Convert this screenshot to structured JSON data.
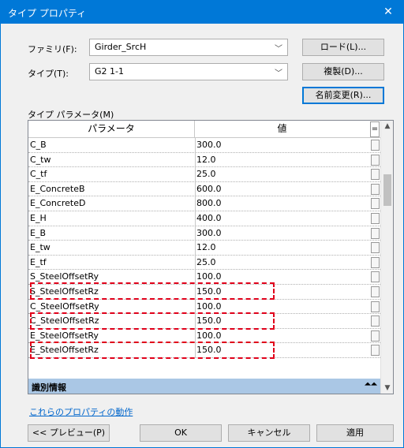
{
  "window": {
    "title": "タイプ プロパティ",
    "close_glyph": "✕"
  },
  "family": {
    "label": "ファミリ(F):",
    "value": "Girder_SrcH"
  },
  "type": {
    "label": "タイプ(T):",
    "value": "G2 1-1"
  },
  "buttons": {
    "load": "ロード(L)...",
    "duplicate": "複製(D)...",
    "rename": "名前変更(R)..."
  },
  "type_params_label": "タイプ パラメータ(M)",
  "grid": {
    "col_param": "パラメータ",
    "col_value": "値",
    "col_extra": "=",
    "rows": [
      {
        "param": "C_B",
        "value": "300.0"
      },
      {
        "param": "C_tw",
        "value": "12.0"
      },
      {
        "param": "C_tf",
        "value": "25.0"
      },
      {
        "param": "E_ConcreteB",
        "value": "600.0"
      },
      {
        "param": "E_ConcreteD",
        "value": "800.0"
      },
      {
        "param": "E_H",
        "value": "400.0"
      },
      {
        "param": "E_B",
        "value": "300.0"
      },
      {
        "param": "E_tw",
        "value": "12.0"
      },
      {
        "param": "E_tf",
        "value": "25.0"
      },
      {
        "param": "S_SteelOffsetRy",
        "value": "100.0"
      },
      {
        "param": "S_SteelOffsetRz",
        "value": "150.0"
      },
      {
        "param": "C_SteelOffsetRy",
        "value": "100.0"
      },
      {
        "param": "C_SteelOffsetRz",
        "value": "150.0"
      },
      {
        "param": "E_SteelOffsetRy",
        "value": "100.0"
      },
      {
        "param": "E_SteelOffsetRz",
        "value": "150.0"
      }
    ],
    "group_label": "識別情報",
    "group_icon": "collapse-icon"
  },
  "link": "これらのプロパティの動作",
  "footer": {
    "preview": "<< プレビュー(P)",
    "ok": "OK",
    "cancel": "キャンセル",
    "apply": "適用"
  },
  "colors": {
    "titlebar": "#0078d7",
    "highlight": "#e0001a",
    "group_header": "#aac7e5"
  }
}
